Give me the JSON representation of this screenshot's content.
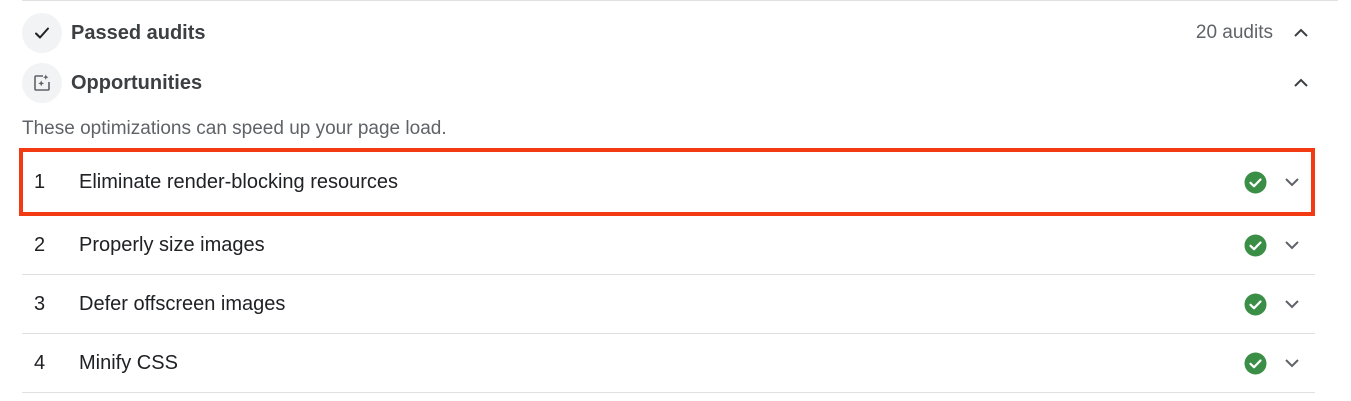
{
  "passed_section": {
    "title": "Passed audits",
    "count": "20 audits",
    "icon": "checkmark-icon",
    "expanded_chevron": "chevron-up-icon"
  },
  "opportunities_section": {
    "title": "Opportunities",
    "icon": "sparkle-frame-icon",
    "expanded_chevron": "chevron-up-icon",
    "description": "These optimizations can speed up your page load."
  },
  "opportunities": [
    {
      "number": "1",
      "label": "Eliminate render-blocking resources",
      "status": "passed",
      "highlighted": true
    },
    {
      "number": "2",
      "label": "Properly size images",
      "status": "passed",
      "highlighted": false
    },
    {
      "number": "3",
      "label": "Defer offscreen images",
      "status": "passed",
      "highlighted": false
    },
    {
      "number": "4",
      "label": "Minify CSS",
      "status": "passed",
      "highlighted": false
    }
  ],
  "colors": {
    "pass_green": "#34a853",
    "highlight_red": "#f23b12",
    "divider": "#e0e0e0"
  }
}
